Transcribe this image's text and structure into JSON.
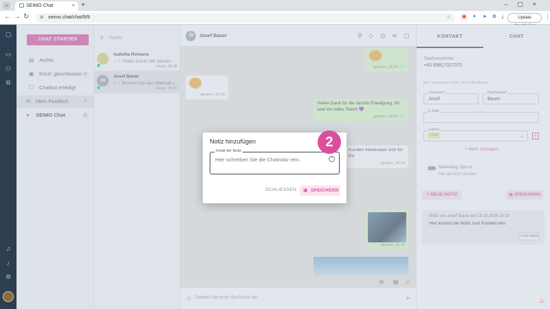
{
  "browser": {
    "tab_title": "SEIMO Chat",
    "url": "seimo.chat/chat/9/9",
    "update_label": "Update abschließen"
  },
  "sidebar": {
    "start_button": "CHAT STARTEN",
    "items": [
      {
        "label": "Archiv",
        "count": ""
      },
      {
        "label": "Kürzl. geschlossen",
        "count": "1"
      },
      {
        "label": "Chatbot erledigt",
        "count": ""
      },
      {
        "label": "Mein Postfach",
        "count": "2"
      },
      {
        "label": "SEIMO Chat",
        "count": "1"
      }
    ]
  },
  "conversations": {
    "search_placeholder": "Suche",
    "items": [
      {
        "initials": "",
        "name": "Isabella Romano",
        "preview": "Vielen Dank! Wir werden",
        "time": "heute, 09:08"
      },
      {
        "initials": "JB",
        "name": "Josef Bauer",
        "preview": "Buchen Sie den Webcall u",
        "time": "heute, 00:37"
      }
    ]
  },
  "chat": {
    "contact_initials": "JB",
    "contact_name": "Josef Bauer",
    "messages": [
      {
        "text": "",
        "time": "gestern, 13:28"
      },
      {
        "text": "",
        "time": "gestern, 13:28"
      },
      {
        "text": "Vielen Dank für die rasche Erledigung. Ihr seid ein tolles Team! 💜",
        "time": "gestern, 13:40"
      },
      {
        "text": "Kunden interessiert sich für KV",
        "time": "gestern, 16:14"
      },
      {
        "text": "",
        "time": "gestern, 16:23"
      }
    ],
    "composer_placeholder": "Geben Sie eine Nachricht ein"
  },
  "contact_panel": {
    "tabs": [
      "KONTAKT",
      "CHAT"
    ],
    "phone_label": "Telefonnummer",
    "phone_value": "+43 69917027072",
    "required_hint": "Mit * markierte Felder sind Pflichtfelder",
    "first_name_label": "Vorname*",
    "first_name": "Josef",
    "last_name_label": "Nachname*",
    "last_name": "Bauer",
    "email_label": "E-Mail",
    "labels_label": "Labels",
    "label_chip": "CRM",
    "more_link": "+ Mehr Anzeigen",
    "optin_title": "Marketing Opt-In",
    "optin_status": "Nie gesetzt worden",
    "new_note_button": "+ NEUE NOTIZ",
    "save_button": "SPEICHERN",
    "note_header": "Notiz von Josef Bauer am 18.10.2024 16:30",
    "note_body": "Hier kommt die Notiz zum Kontakt rein.",
    "delete_button": "LÖSCHEN"
  },
  "modal": {
    "title": "Notiz hinzufügen",
    "field_label": "Inhalt der Notiz",
    "field_placeholder": "Hier schreiben Sie die Chatnotiz rein.",
    "close_button": "SCHLIESSEN",
    "save_button": "SPEICHERN"
  },
  "step_badge": "2",
  "colors": {
    "accent": "#d94f9c",
    "rail": "#2c3e50",
    "overlay": "#becad6"
  }
}
